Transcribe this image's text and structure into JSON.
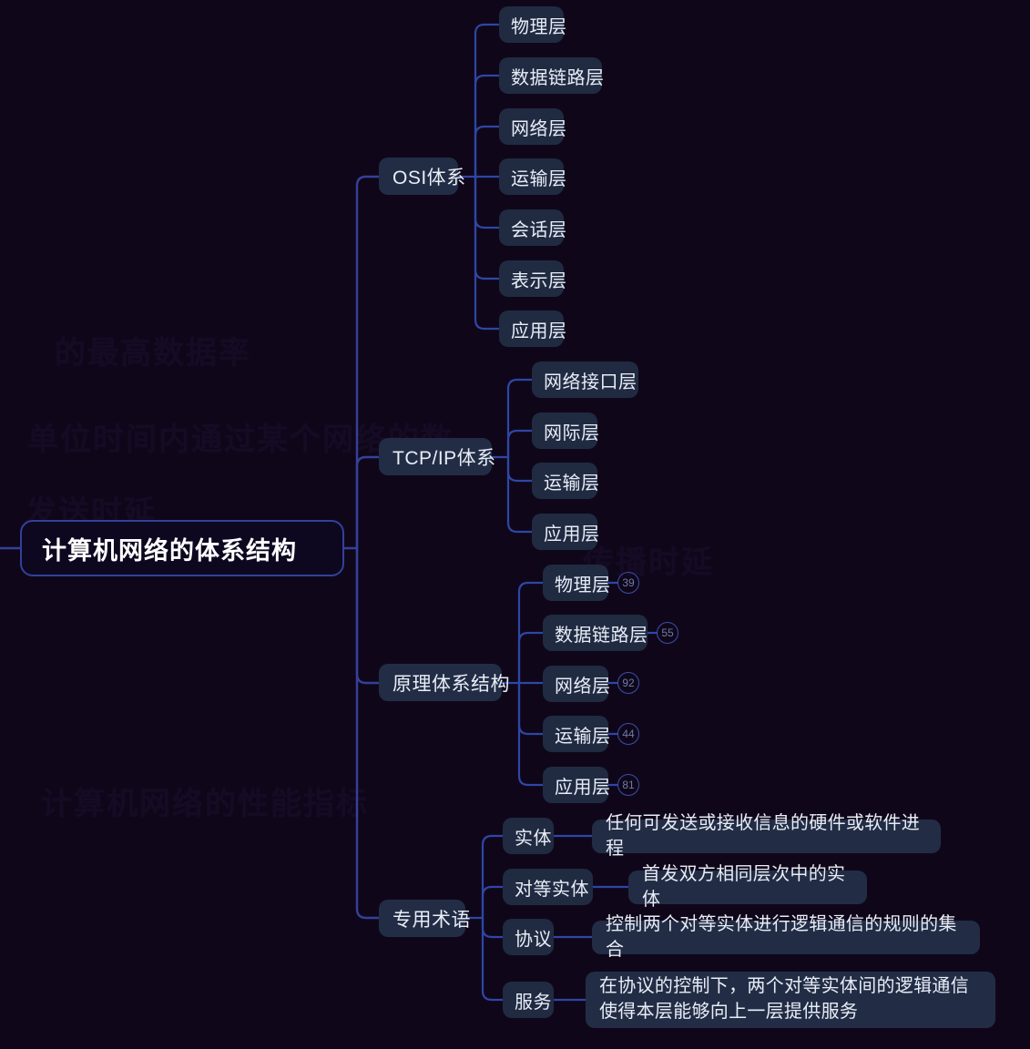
{
  "map": {
    "root": {
      "label": "计算机网络的体系结构"
    },
    "branches": [
      {
        "label": "OSI体系",
        "children": [
          {
            "label": "物理层"
          },
          {
            "label": "数据链路层"
          },
          {
            "label": "网络层"
          },
          {
            "label": "运输层"
          },
          {
            "label": "会话层"
          },
          {
            "label": "表示层"
          },
          {
            "label": "应用层"
          }
        ]
      },
      {
        "label": "TCP/IP体系",
        "children": [
          {
            "label": "网络接口层"
          },
          {
            "label": "网际层"
          },
          {
            "label": "运输层"
          },
          {
            "label": "应用层"
          }
        ]
      },
      {
        "label": "原理体系结构",
        "children": [
          {
            "label": "物理层",
            "badge": "39"
          },
          {
            "label": "数据链路层",
            "badge": "55"
          },
          {
            "label": "网络层",
            "badge": "92"
          },
          {
            "label": "运输层",
            "badge": "44"
          },
          {
            "label": "应用层",
            "badge": "81"
          }
        ]
      },
      {
        "label": "专用术语",
        "children": [
          {
            "label": "实体",
            "detail": "任何可发送或接收信息的硬件或软件进程"
          },
          {
            "label": "对等实体",
            "detail": "首发双方相同层次中的实体"
          },
          {
            "label": "协议",
            "detail": "控制两个对等实体进行逻辑通信的规则的集合"
          },
          {
            "label": "服务",
            "detail": "在协议的控制下，两个对等实体间的逻辑通信使得本层能够向上一层提供服务"
          }
        ]
      }
    ]
  },
  "watermark": {
    "lines": [
      "的最高数据率",
      "单位时间内通过某个网络的数",
      "发送时延",
      "传播时延",
      "计算机网络的性能指标"
    ]
  },
  "colors": {
    "background": "#0f0719",
    "node_fill": "#222d45",
    "connector": "#2f46a6",
    "root_border": "#34409a",
    "text": "#e8edf7",
    "badge_text": "#6f7ba8"
  }
}
